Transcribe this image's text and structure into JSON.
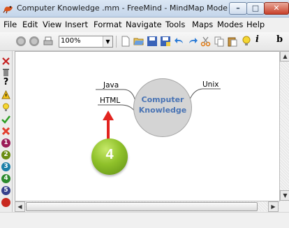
{
  "window": {
    "title": "Computer Knowledge .mm - FreeMind - MindMap Mode",
    "icon": "freemind-app-icon",
    "controls": {
      "minimize": "–",
      "maximize": "□",
      "close": "✕"
    }
  },
  "menu": {
    "items": [
      "File",
      "Edit",
      "View",
      "Insert",
      "Format",
      "Navigate",
      "Tools",
      "Maps",
      "Modes",
      "Help"
    ]
  },
  "toolbar": {
    "zoom_value": "100%",
    "zoom_arrow": "▼",
    "icons": [
      "back-icon",
      "forward-icon",
      "print-icon",
      "new-file-icon",
      "open-folder-icon",
      "save-icon",
      "save-as-icon",
      "undo-icon",
      "redo-icon",
      "cut-icon",
      "copy-icon",
      "paste-icon",
      "lightbulb-icon",
      "italic-icon",
      "bold-icon"
    ],
    "italic_label": "i",
    "bold_label": "b"
  },
  "icon_bar": {
    "icons": [
      "remove-icon-x",
      "trash-icon",
      "question-icon",
      "warning-icon",
      "idea-icon",
      "checkmark-icon",
      "cross-icon",
      "priority-1-icon",
      "priority-2-icon",
      "priority-3-icon",
      "priority-4-icon",
      "priority-5-icon"
    ],
    "question_label": "?",
    "priority_labels": [
      "1",
      "2",
      "3",
      "4",
      "5"
    ]
  },
  "mindmap": {
    "root": {
      "line1": "Computer",
      "line2": "Knowledge",
      "color": "#4a74b4"
    },
    "left_nodes": [
      "Java",
      "HTML"
    ],
    "right_nodes": [
      "Unix"
    ]
  },
  "annotation": {
    "step_number": "4",
    "arrow_color": "#e2241f",
    "badge_color": "#8fc12a"
  },
  "scrollbars": {
    "left_arrow": "◀",
    "right_arrow": "▶",
    "up_arrow": "▲",
    "down_arrow": "▼"
  }
}
